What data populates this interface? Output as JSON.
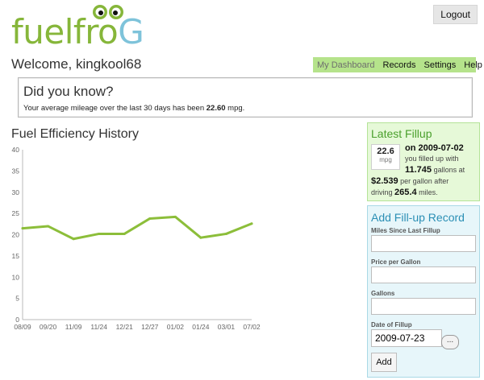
{
  "brand": {
    "logo_main": "fuelfro",
    "logo_end": "G"
  },
  "header": {
    "logout_label": "Logout",
    "welcome": "Welcome, kingkool68"
  },
  "nav": {
    "items": [
      "My Dashboard",
      "Records",
      "Settings",
      "Help"
    ],
    "active": "My Dashboard"
  },
  "tip": {
    "title": "Did you know?",
    "prefix": "Your average mileage over the last 30 days has been ",
    "value": "22.60",
    "suffix": " mpg."
  },
  "chart_title": "Fuel Efficiency History",
  "chart_data": {
    "type": "line",
    "categories": [
      "08/09",
      "09/20",
      "11/09",
      "11/24",
      "12/21",
      "12/27",
      "01/02",
      "01/24",
      "03/01",
      "07/02"
    ],
    "series": [
      {
        "values": [
          21.5,
          22.0,
          19.0,
          20.2,
          20.2,
          23.8,
          24.2,
          19.3,
          20.2,
          22.6
        ]
      }
    ],
    "ylim": [
      0,
      40
    ],
    "yticks": [
      0,
      5,
      10,
      15,
      20,
      25,
      30,
      35,
      40
    ],
    "colors": {
      "line": "#8cbe3a",
      "axis": "#b8b8b8"
    },
    "grid": false
  },
  "latest": {
    "title": "Latest Fillup",
    "mpg_value": "22.6",
    "mpg_unit": "mpg",
    "on_text": "on 2009-07-02",
    "filled_text": "you filled up with",
    "gallons": "11.745",
    "gallons_at": "gallons at",
    "price": "$2.539",
    "price_text": "per gallon after",
    "driving_text": "driving",
    "miles": "265.4",
    "miles_text": "miles."
  },
  "form": {
    "title": "Add Fill-up Record",
    "miles_label": "Miles Since Last Fillup",
    "price_label": "Price per Gallon",
    "gallons_label": "Gallons",
    "date_label": "Date of Fillup",
    "date_value": "2009-07-23",
    "picker_label": "...",
    "add_label": "Add"
  },
  "colors": {
    "accent_green": "#86b63a",
    "nav_bg": "#b5e38b",
    "form_bg": "#e7f6fa",
    "latest_bg": "#e6f9d8"
  }
}
